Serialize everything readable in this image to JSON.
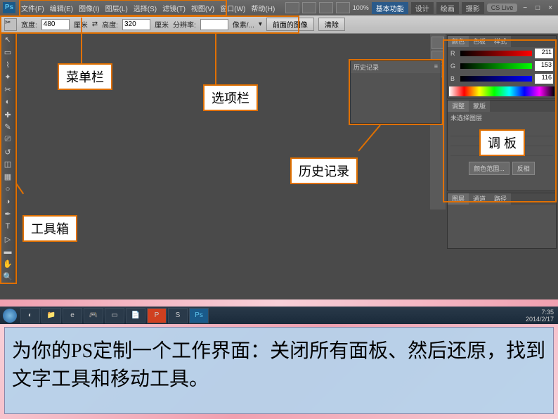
{
  "app": {
    "logo": "Ps"
  },
  "menu": {
    "items": [
      "文件(F)",
      "编辑(E)",
      "图像(I)",
      "图层(L)",
      "选择(S)",
      "滤镜(T)",
      "视图(V)",
      "窗口(W)",
      "帮助(H)"
    ],
    "zoom": "100%",
    "workspaces": [
      "基本功能",
      "设计",
      "绘画",
      "摄影"
    ],
    "cslive": "CS Live"
  },
  "options": {
    "width_label": "宽度:",
    "width_value": "480",
    "width_unit": "厘米",
    "height_label": "高度:",
    "height_value": "320",
    "height_unit": "厘米",
    "res_label": "分辨率:",
    "res_value": "",
    "res_unit": "像素/...",
    "front_btn": "前面的图像",
    "clear_btn": "清除"
  },
  "color_panel": {
    "tabs": [
      "颜色",
      "色板",
      "样式"
    ],
    "r_label": "R",
    "r_val": "211",
    "g_label": "G",
    "g_val": "153",
    "b_label": "B",
    "b_val": "116"
  },
  "adjust_panel": {
    "title": "未选择图层",
    "tab1": "调整",
    "tab2": "蒙版",
    "btn_range": "颜色范围...",
    "btn_invert": "反相"
  },
  "layers_panel": {
    "tabs": [
      "图层",
      "通道",
      "路径"
    ]
  },
  "history": {
    "title": "历史记录"
  },
  "taskbar": {
    "time": "7:35",
    "date": "2014/2/17"
  },
  "callouts": {
    "menu": "菜单栏",
    "options": "选项栏",
    "toolbox": "工具箱",
    "history": "历史记录",
    "panels": "调    板"
  },
  "instruction": "为你的PS定制一个工作界面：关闭所有面板、然后还原，找到文字工具和移动工具。"
}
